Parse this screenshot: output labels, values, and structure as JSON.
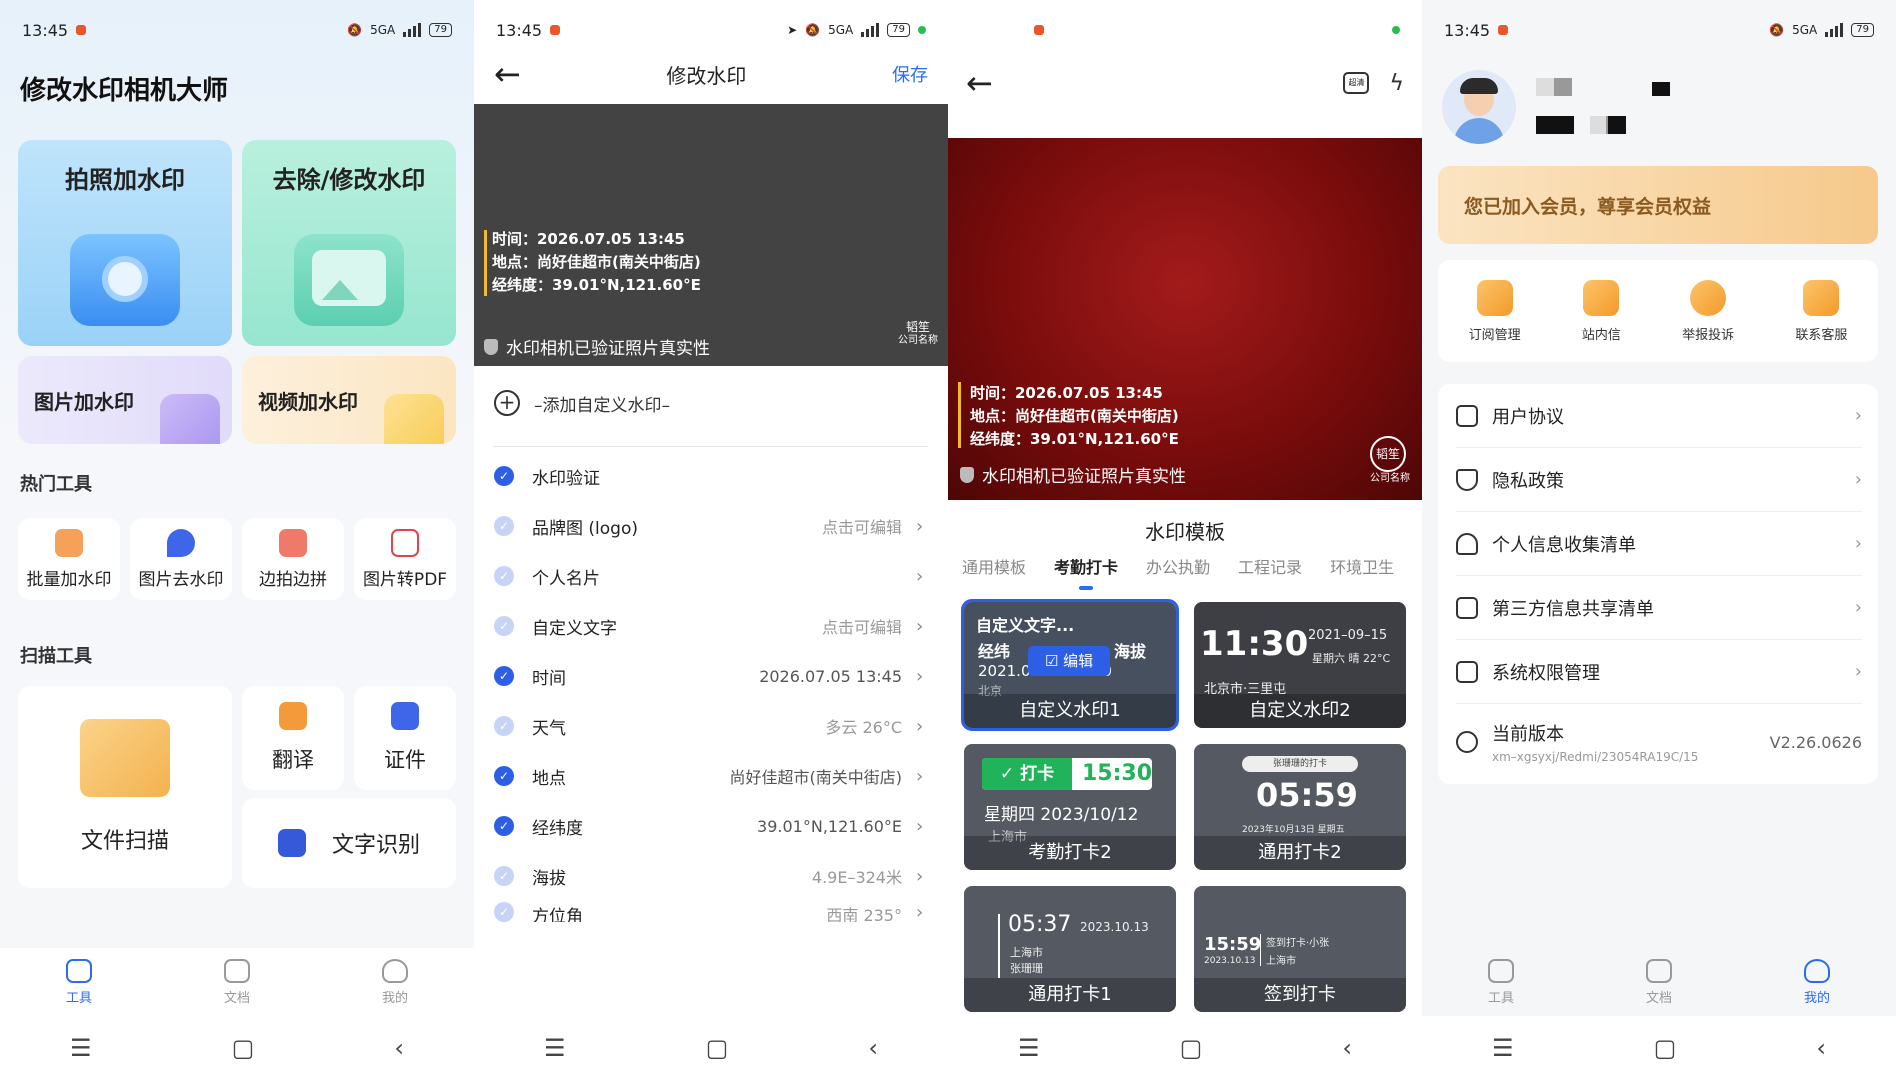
{
  "status": {
    "time": "13:45",
    "battery": "79",
    "net": "5GA"
  },
  "s1": {
    "title": "修改水印相机大师",
    "card_photo": "拍照加水印",
    "card_remove": "去除/修改水印",
    "card_image": "图片加水印",
    "card_video": "视频加水印",
    "hot_title": "热门工具",
    "hot_tools": [
      "批量加水印",
      "图片去水印",
      "边拍边拼",
      "图片转PDF"
    ],
    "scan_title": "扫描工具",
    "scan_file": "文件扫描",
    "translate": "翻译",
    "certificate": "证件",
    "ocr": "文字识别"
  },
  "tabs": {
    "tools": "工具",
    "docs": "文档",
    "mine": "我的"
  },
  "s2": {
    "title": "修改水印",
    "save": "保存",
    "wm_time": "时间：2026.07.05 13:45",
    "wm_place": "地点：尚好佳超市(南关中街店)",
    "wm_coord": "经纬度：39.01°N,121.60°E",
    "verify": "水印相机已验证照片真实性",
    "company_top": "韬笙",
    "company_bottom": "公司名称",
    "add_custom": "–添加自定义水印–",
    "rows": [
      {
        "label": "水印验证",
        "value": ""
      },
      {
        "label": "品牌图 (logo)",
        "value": "点击可编辑"
      },
      {
        "label": "个人名片",
        "value": ""
      },
      {
        "label": "自定义文字",
        "value": "点击可编辑"
      },
      {
        "label": "时间",
        "value": "2026.07.05 13:45"
      },
      {
        "label": "天气",
        "value": "多云 26°C"
      },
      {
        "label": "地点",
        "value": "尚好佳超市(南关中街店)"
      },
      {
        "label": "经纬度",
        "value": "39.01°N,121.60°E"
      },
      {
        "label": "海拔",
        "value": "4.9E–324米"
      },
      {
        "label": "方位角",
        "value": "西南 235°"
      }
    ]
  },
  "s3": {
    "quality": "超清",
    "panel_title": "水印模板",
    "categories": [
      "通用模板",
      "考勤打卡",
      "办公执勤",
      "工程记录",
      "环境卫生"
    ],
    "templates": {
      "t1": {
        "name": "自定义水印1",
        "headline": "自定义文字...",
        "edit": "编辑",
        "row2a": "经纬",
        "row2b": "海拔",
        "row3": "2021.09.15 11:30",
        "row4": "北京"
      },
      "t2": {
        "name": "自定义水印2",
        "time": "11:30",
        "date": "2021–09–15",
        "weekday": "星期六 晴 22°C",
        "place": "北京市·三里屯"
      },
      "t3": {
        "name": "考勤打卡2",
        "badge": "✓ 打卡",
        "time": "15:30",
        "date": "星期四 2023/10/12",
        "place": "上海市"
      },
      "t4": {
        "name": "通用打卡2",
        "header": "张珊珊的打卡",
        "time": "05:59",
        "date": "2023年10月13日 星期五"
      },
      "t5": {
        "name": "通用打卡1",
        "time": "05:37",
        "date": "2023.10.13",
        "place": "上海市",
        "person": "张珊珊"
      },
      "t6": {
        "name": "签到打卡",
        "time": "15:59",
        "date": "2023.10.13",
        "sub1": "签到打卡·小张",
        "sub2": "上海市"
      }
    }
  },
  "s4": {
    "vip": "您已加入会员，尊享会员权益",
    "quick": [
      "订阅管理",
      "站内信",
      "举报投诉",
      "联系客服"
    ],
    "menu": [
      "用户协议",
      "隐私政策",
      "个人信息收集清单",
      "第三方信息共享清单",
      "系统权限管理"
    ],
    "version_label": "当前版本",
    "version_sub": "xm–xgsyxj/Redmi/23054RA19C/15",
    "version_value": "V2.26.0626"
  },
  "colors": {
    "accent": "#2b6cf0",
    "check": "#2d5fe6",
    "vip_text": "#8a5a20"
  }
}
